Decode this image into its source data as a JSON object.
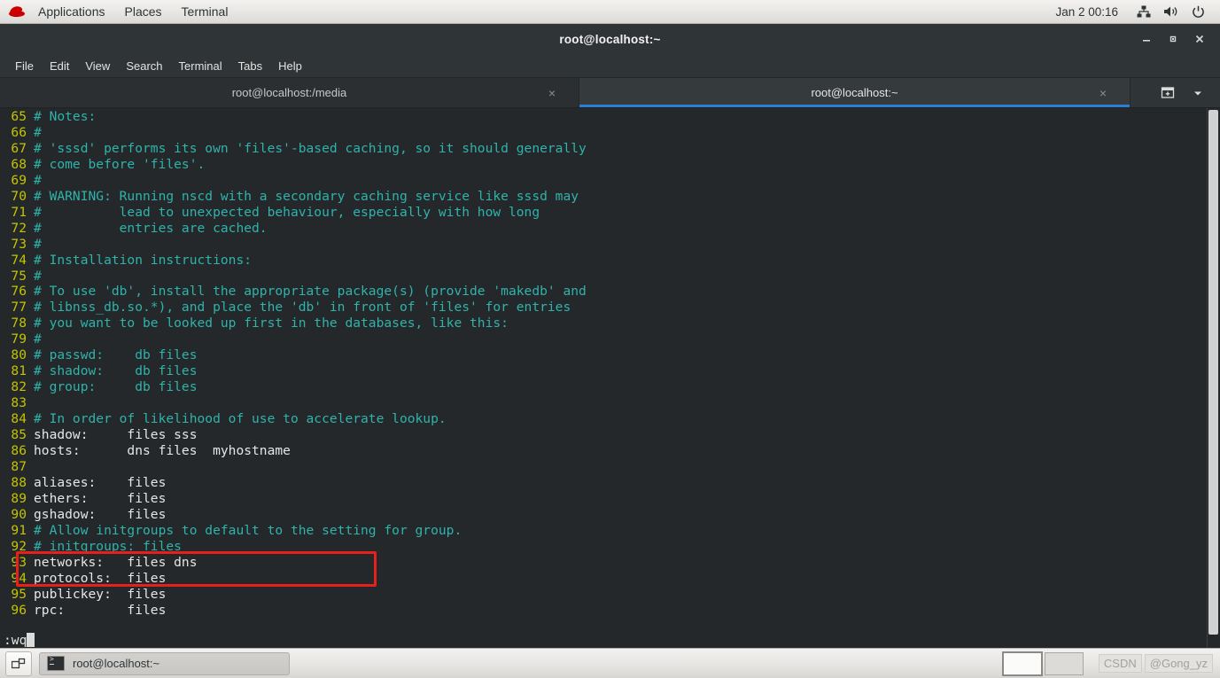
{
  "top_panel": {
    "logo_icon": "redhat-logo-icon",
    "menus": [
      {
        "label": "Applications"
      },
      {
        "label": "Places"
      },
      {
        "label": "Terminal"
      }
    ],
    "clock": "Jan 2  00:16",
    "tray": [
      {
        "icon": "network-icon"
      },
      {
        "icon": "volume-icon"
      },
      {
        "icon": "power-icon"
      }
    ]
  },
  "window": {
    "title": "root@localhost:~",
    "controls": [
      {
        "name": "minimize",
        "glyph": "—"
      },
      {
        "name": "maximize",
        "glyph": "■"
      },
      {
        "name": "close",
        "glyph": "✕"
      }
    ],
    "menu_bar": [
      {
        "label": "File"
      },
      {
        "label": "Edit"
      },
      {
        "label": "View"
      },
      {
        "label": "Search"
      },
      {
        "label": "Terminal"
      },
      {
        "label": "Tabs"
      },
      {
        "label": "Help"
      }
    ],
    "tabs": [
      {
        "label": "root@localhost:/media",
        "active": false,
        "close_glyph": "×"
      },
      {
        "label": "root@localhost:~",
        "active": true,
        "close_glyph": "×"
      }
    ],
    "tab_actions": [
      {
        "icon": "new-tab-icon"
      },
      {
        "icon": "chevron-down-icon"
      }
    ]
  },
  "terminal": {
    "accent_blue": "#2a7fd4",
    "background": "#24282a",
    "comment_color": "#2fb3ab",
    "linenumber_color": "#c4c400",
    "text_color": "#e6e6e6",
    "lines": [
      {
        "n": "65",
        "text": "# Notes:",
        "kind": "comment"
      },
      {
        "n": "66",
        "text": "#",
        "kind": "comment"
      },
      {
        "n": "67",
        "text": "# 'sssd' performs its own 'files'-based caching, so it should generally",
        "kind": "comment"
      },
      {
        "n": "68",
        "text": "# come before 'files'.",
        "kind": "comment"
      },
      {
        "n": "69",
        "text": "#",
        "kind": "comment"
      },
      {
        "n": "70",
        "text": "# WARNING: Running nscd with a secondary caching service like sssd may",
        "kind": "comment"
      },
      {
        "n": "71",
        "text": "#          lead to unexpected behaviour, especially with how long",
        "kind": "comment"
      },
      {
        "n": "72",
        "text": "#          entries are cached.",
        "kind": "comment"
      },
      {
        "n": "73",
        "text": "#",
        "kind": "comment"
      },
      {
        "n": "74",
        "text": "# Installation instructions:",
        "kind": "comment"
      },
      {
        "n": "75",
        "text": "#",
        "kind": "comment"
      },
      {
        "n": "76",
        "text": "# To use 'db', install the appropriate package(s) (provide 'makedb' and",
        "kind": "comment"
      },
      {
        "n": "77",
        "text": "# libnss_db.so.*), and place the 'db' in front of 'files' for entries",
        "kind": "comment"
      },
      {
        "n": "78",
        "text": "# you want to be looked up first in the databases, like this:",
        "kind": "comment"
      },
      {
        "n": "79",
        "text": "#",
        "kind": "comment"
      },
      {
        "n": "80",
        "text": "# passwd:    db files",
        "kind": "comment"
      },
      {
        "n": "81",
        "text": "# shadow:    db files",
        "kind": "comment"
      },
      {
        "n": "82",
        "text": "# group:     db files",
        "kind": "comment"
      },
      {
        "n": "83",
        "text": "",
        "kind": "plain"
      },
      {
        "n": "84",
        "text": "# In order of likelihood of use to accelerate lookup.",
        "kind": "comment"
      },
      {
        "n": "85",
        "text": "shadow:     files sss",
        "kind": "plain"
      },
      {
        "n": "86",
        "text": "hosts:      dns files  myhostname",
        "kind": "plain"
      },
      {
        "n": "87",
        "text": "",
        "kind": "plain"
      },
      {
        "n": "88",
        "text": "aliases:    files",
        "kind": "plain"
      },
      {
        "n": "89",
        "text": "ethers:     files",
        "kind": "plain"
      },
      {
        "n": "90",
        "text": "gshadow:    files",
        "kind": "plain"
      },
      {
        "n": "91",
        "text": "# Allow initgroups to default to the setting for group.",
        "kind": "comment"
      },
      {
        "n": "92",
        "text": "# initgroups: files",
        "kind": "comment"
      },
      {
        "n": "93",
        "text": "networks:   files dns",
        "kind": "plain"
      },
      {
        "n": "94",
        "text": "protocols:  files",
        "kind": "plain"
      },
      {
        "n": "95",
        "text": "publickey:  files",
        "kind": "plain"
      },
      {
        "n": "96",
        "text": "rpc:        files",
        "kind": "plain"
      }
    ],
    "command_line": ":wq",
    "annotation": {
      "shape": "rectangle",
      "color": "#e8201c",
      "covers_lines": "85-87"
    }
  },
  "taskbar": {
    "show_desktop_icon": "show-desktop-icon",
    "task": {
      "label": "root@localhost:~",
      "icon": "terminal-icon"
    },
    "workspaces": [
      {
        "active": true
      },
      {
        "active": false
      }
    ],
    "watermark": [
      "CSDN",
      "@Gong_yz"
    ]
  }
}
